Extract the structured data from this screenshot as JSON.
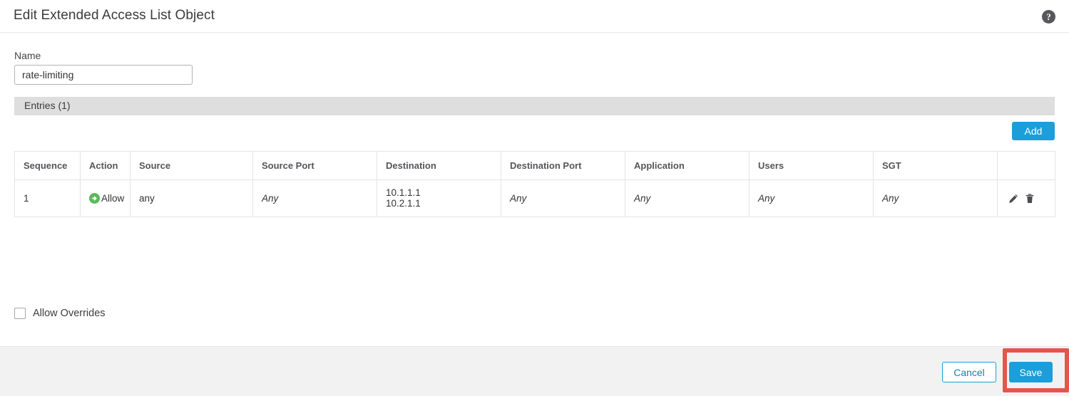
{
  "dialog": {
    "title": "Edit Extended Access List Object",
    "help_icon": "help-circle-icon",
    "help_glyph": "?"
  },
  "form": {
    "name_label": "Name",
    "name_value": "rate-limiting",
    "name_placeholder": ""
  },
  "entries_section": {
    "header": "Entries (1)",
    "add_label": "Add"
  },
  "table": {
    "columns": [
      "Sequence",
      "Action",
      "Source",
      "Source Port",
      "Destination",
      "Destination Port",
      "Application",
      "Users",
      "SGT",
      ""
    ],
    "rows": [
      {
        "sequence": "1",
        "action": "Allow",
        "action_icon": "allow-arrow-icon",
        "source": "any",
        "source_port": "Any",
        "destination_line1": "10.1.1.1",
        "destination_line2": "10.2.1.1",
        "destination_port": "Any",
        "application": "Any",
        "users": "Any",
        "sgt": "Any",
        "edit_icon": "pencil-icon",
        "delete_icon": "trash-icon"
      }
    ]
  },
  "options": {
    "allow_overrides_label": "Allow Overrides",
    "allow_overrides_checked": false
  },
  "footer": {
    "cancel_label": "Cancel",
    "save_label": "Save"
  },
  "colors": {
    "accent_blue": "#1b9ed9",
    "allow_green": "#5cb85c",
    "highlight_red": "#e2574c",
    "section_gray": "#dedede",
    "footer_gray": "#f2f2f2"
  }
}
